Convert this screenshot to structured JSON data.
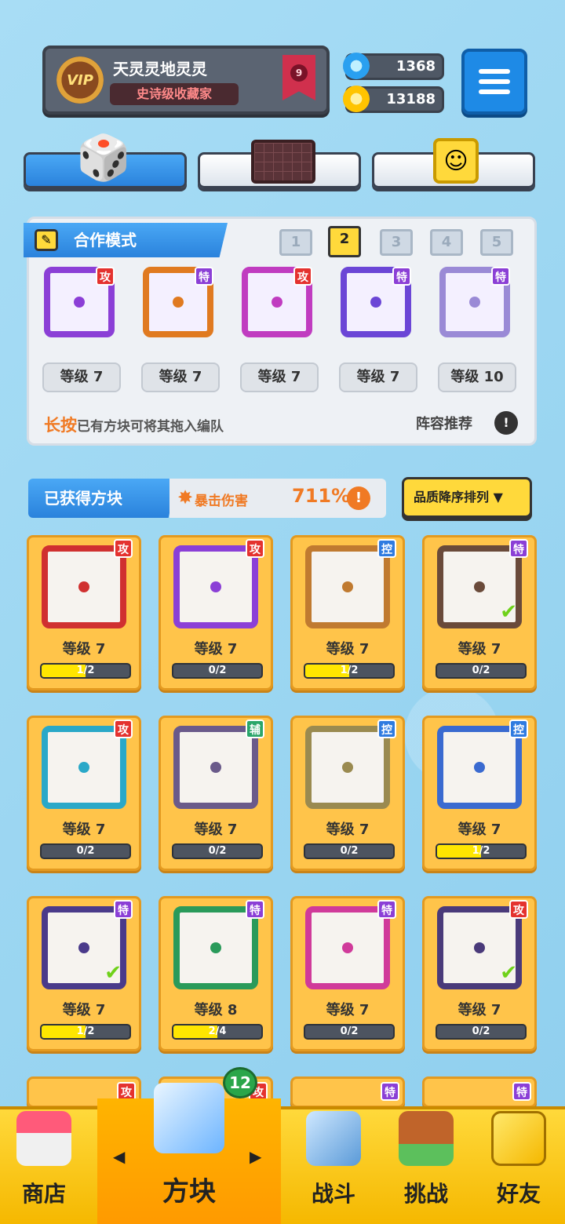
{
  "profile": {
    "name": "天灵灵地灵灵",
    "title": "史诗级收藏家",
    "vip": "VIP",
    "rank": "9"
  },
  "currency": {
    "gems": "1368",
    "coins": "13188"
  },
  "coop": {
    "title": "合作模式",
    "pages": [
      "1",
      "2",
      "3",
      "4",
      "5"
    ],
    "selected_page": "2"
  },
  "deck": [
    {
      "tag": "攻",
      "level": "等级 7",
      "color": "#8b3fd6"
    },
    {
      "tag": "特",
      "level": "等级 7",
      "color": "#e07a20"
    },
    {
      "tag": "攻",
      "level": "等级 7",
      "color": "#c03cc0"
    },
    {
      "tag": "特",
      "level": "等级 7",
      "color": "#6b46d6"
    },
    {
      "tag": "特",
      "level": "等级 10",
      "color": "#9a8ad6"
    }
  ],
  "hint": {
    "highlight": "长按",
    "text": "已有方块可将其拖入编队",
    "recommend": "阵容推荐"
  },
  "obtained": {
    "title": "已获得方块",
    "crit_label": "暴击伤害",
    "crit_value": "711%",
    "sort_label": "品质降序排列"
  },
  "cards": [
    {
      "tag": "攻",
      "level": "等级 7",
      "progress": "1/2",
      "fill": 0.5,
      "color": "#d03030",
      "check": false
    },
    {
      "tag": "攻",
      "level": "等级 7",
      "progress": "0/2",
      "fill": 0,
      "color": "#8b3fd6",
      "check": false
    },
    {
      "tag": "控",
      "level": "等级 7",
      "progress": "1/2",
      "fill": 0.5,
      "color": "#c07a30",
      "check": false
    },
    {
      "tag": "特",
      "level": "等级 7",
      "progress": "0/2",
      "fill": 0,
      "color": "#6a4a3a",
      "check": true
    },
    {
      "tag": "攻",
      "level": "等级 7",
      "progress": "0/2",
      "fill": 0,
      "color": "#2aa8c8",
      "check": false
    },
    {
      "tag": "辅",
      "level": "等级 7",
      "progress": "0/2",
      "fill": 0,
      "color": "#6a5a8a",
      "check": false
    },
    {
      "tag": "控",
      "level": "等级 7",
      "progress": "0/2",
      "fill": 0,
      "color": "#9a8a50",
      "check": false
    },
    {
      "tag": "控",
      "level": "等级 7",
      "progress": "1/2",
      "fill": 0.5,
      "color": "#3a6ad0",
      "check": false
    },
    {
      "tag": "特",
      "level": "等级 7",
      "progress": "1/2",
      "fill": 0.5,
      "color": "#4a3a8a",
      "check": true
    },
    {
      "tag": "特",
      "level": "等级 8",
      "progress": "2/4",
      "fill": 0.5,
      "color": "#2a9a5a",
      "check": false
    },
    {
      "tag": "特",
      "level": "等级 7",
      "progress": "0/2",
      "fill": 0,
      "color": "#d03a9a",
      "check": false
    },
    {
      "tag": "攻",
      "level": "等级 7",
      "progress": "0/2",
      "fill": 0,
      "color": "#4a3a7a",
      "check": true
    }
  ],
  "partial_tags": [
    "攻",
    "攻",
    "特",
    "特"
  ],
  "nav": {
    "shop": "商店",
    "blocks": "方块",
    "battle": "战斗",
    "challenge": "挑战",
    "friends": "好友",
    "badge": "12"
  }
}
